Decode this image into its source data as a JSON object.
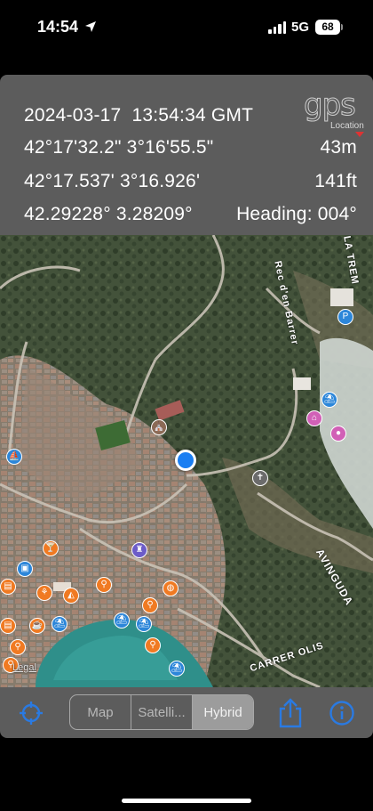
{
  "status_bar": {
    "time": "14:54",
    "network": "5G",
    "battery": "68"
  },
  "info": {
    "datetime": "2024-03-17  13:54:34 GMT",
    "dms": "42°17'32.2\" 3°16'55.5\"",
    "altitude_m": "43m",
    "dm": "42°17.537' 3°16.926'",
    "altitude_ft": "141ft",
    "decimal": "42.29228° 3.28209°",
    "heading": "Heading: 004°",
    "logo_text": "gps",
    "logo_sub": "Location"
  },
  "map": {
    "streets": [
      "Rec d'en Barrer",
      "AVINGUDA",
      "CARRER OLIS",
      "LA TREM"
    ],
    "legal": "Legal"
  },
  "toolbar": {
    "map_types": [
      "Map",
      "Satelli...",
      "Hybrid"
    ],
    "selected": "Hybrid"
  },
  "colors": {
    "panel_bg": "#5c5c5c",
    "accent": "#2a7ae2",
    "user_dot": "#1a7ef2"
  },
  "icons": [
    "location-arrow-icon",
    "crosshair-icon",
    "share-icon",
    "info-icon"
  ]
}
